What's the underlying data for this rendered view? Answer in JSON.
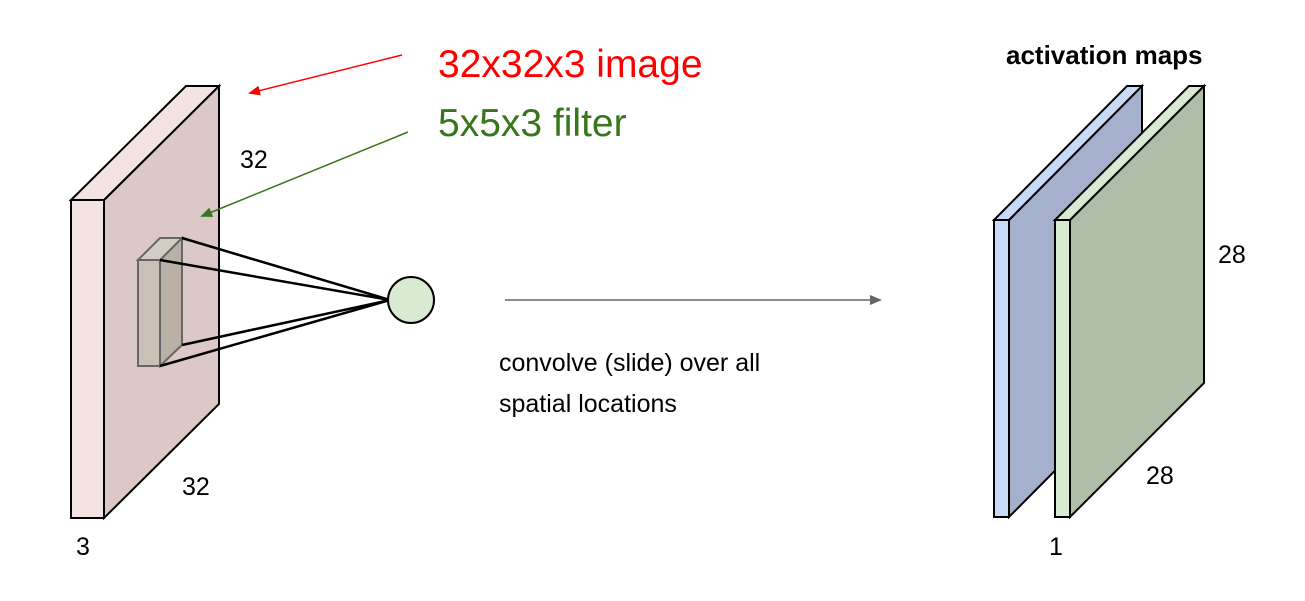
{
  "title": "activation maps",
  "image_label": "32x32x3 image",
  "filter_label": "5x5x3 filter",
  "input_volume": {
    "height": "32",
    "width": "32",
    "depth": "3"
  },
  "operation": {
    "line1": "convolve (slide) over all",
    "line2": "spatial locations"
  },
  "output_volume": {
    "height": "28",
    "width": "28",
    "depth": "1"
  },
  "colors": {
    "image_label": "#ff0000",
    "filter_label": "#38761d",
    "input_front": "#f4e3e3",
    "input_face": "#ddc8c8",
    "filter_face": "#c9c0b6",
    "neuron": "#d9ead3",
    "map_blue_face": "#a5b1cc",
    "map_blue_edge": "#c9daf8",
    "map_green_face": "#b1bea7",
    "map_green_edge": "#d9ead3"
  }
}
